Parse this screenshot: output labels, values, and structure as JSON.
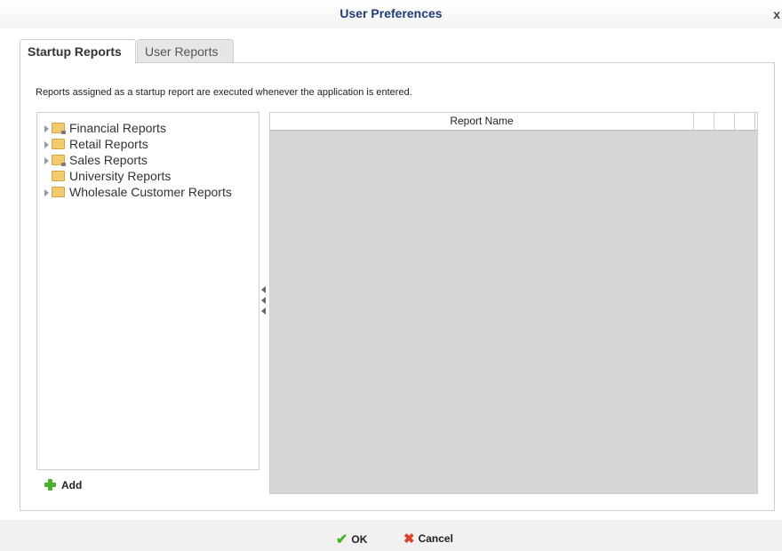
{
  "window": {
    "title": "User Preferences",
    "close_symbol": "x"
  },
  "tabs": [
    {
      "label": "Startup Reports",
      "selected": true
    },
    {
      "label": "User Reports",
      "selected": false
    }
  ],
  "description": "Reports assigned as a startup report are executed whenever the application is entered.",
  "tree": {
    "items": [
      {
        "label": "Financial Reports",
        "expandable": true,
        "locked": true,
        "icon": "folder-icon"
      },
      {
        "label": "Retail Reports",
        "expandable": true,
        "locked": false,
        "icon": "folder-icon"
      },
      {
        "label": "Sales Reports",
        "expandable": true,
        "locked": true,
        "icon": "folder-icon"
      },
      {
        "label": "University Reports",
        "expandable": false,
        "locked": false,
        "icon": "folder-icon"
      },
      {
        "label": "Wholesale Customer Reports",
        "expandable": true,
        "locked": false,
        "icon": "folder-icon"
      }
    ]
  },
  "grid": {
    "columns": [
      "Report Name",
      "",
      "",
      ""
    ],
    "rows": []
  },
  "actions": {
    "add_label": "Add"
  },
  "footer": {
    "ok_label": "OK",
    "cancel_label": "Cancel"
  },
  "colors": {
    "title": "#1f3b78",
    "add_icon": "#4caf30",
    "ok_icon": "#4caf30",
    "cancel_icon": "#e0402a",
    "folder": "#f2c870",
    "grid_bg": "#d6d6d6"
  }
}
